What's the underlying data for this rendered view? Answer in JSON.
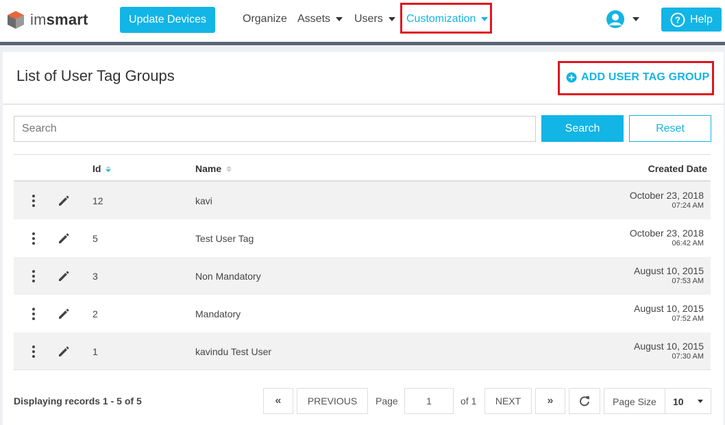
{
  "app": {
    "logo_text_light": "im",
    "logo_text_bold": "smart"
  },
  "nav": {
    "update_devices": "Update Devices",
    "items": [
      {
        "label": "Organize",
        "has_caret": false
      },
      {
        "label": "Assets",
        "has_caret": true
      },
      {
        "label": "Users",
        "has_caret": true
      },
      {
        "label": "Customization",
        "has_caret": true,
        "active": true
      }
    ],
    "help": "Help"
  },
  "page": {
    "title": "List of User Tag Groups",
    "add_button": "ADD USER TAG GROUP"
  },
  "search": {
    "placeholder": "Search",
    "search_button": "Search",
    "reset_button": "Reset"
  },
  "table": {
    "headers": {
      "id": "Id",
      "name": "Name",
      "created": "Created Date"
    },
    "rows": [
      {
        "id": "12",
        "name": "kavi",
        "date": "October 23, 2018",
        "time": "07:24 AM"
      },
      {
        "id": "5",
        "name": "Test User Tag",
        "date": "October 23, 2018",
        "time": "06:42 AM"
      },
      {
        "id": "3",
        "name": "Non Mandatory",
        "date": "August 10, 2015",
        "time": "07:53 AM"
      },
      {
        "id": "2",
        "name": "Mandatory",
        "date": "August 10, 2015",
        "time": "07:52 AM"
      },
      {
        "id": "1",
        "name": "kavindu Test User",
        "date": "August 10, 2015",
        "time": "07:30 AM"
      }
    ]
  },
  "pagination": {
    "summary": "Displaying records 1 - 5 of 5",
    "first": "«",
    "previous": "PREVIOUS",
    "page_label": "Page",
    "page_value": "1",
    "of_label": "of 1",
    "next": "NEXT",
    "last": "»",
    "page_size_label": "Page Size",
    "page_size_value": "10"
  },
  "colors": {
    "accent": "#12b5e5",
    "highlight": "#e0141e",
    "nav_border": "#5a6478"
  }
}
